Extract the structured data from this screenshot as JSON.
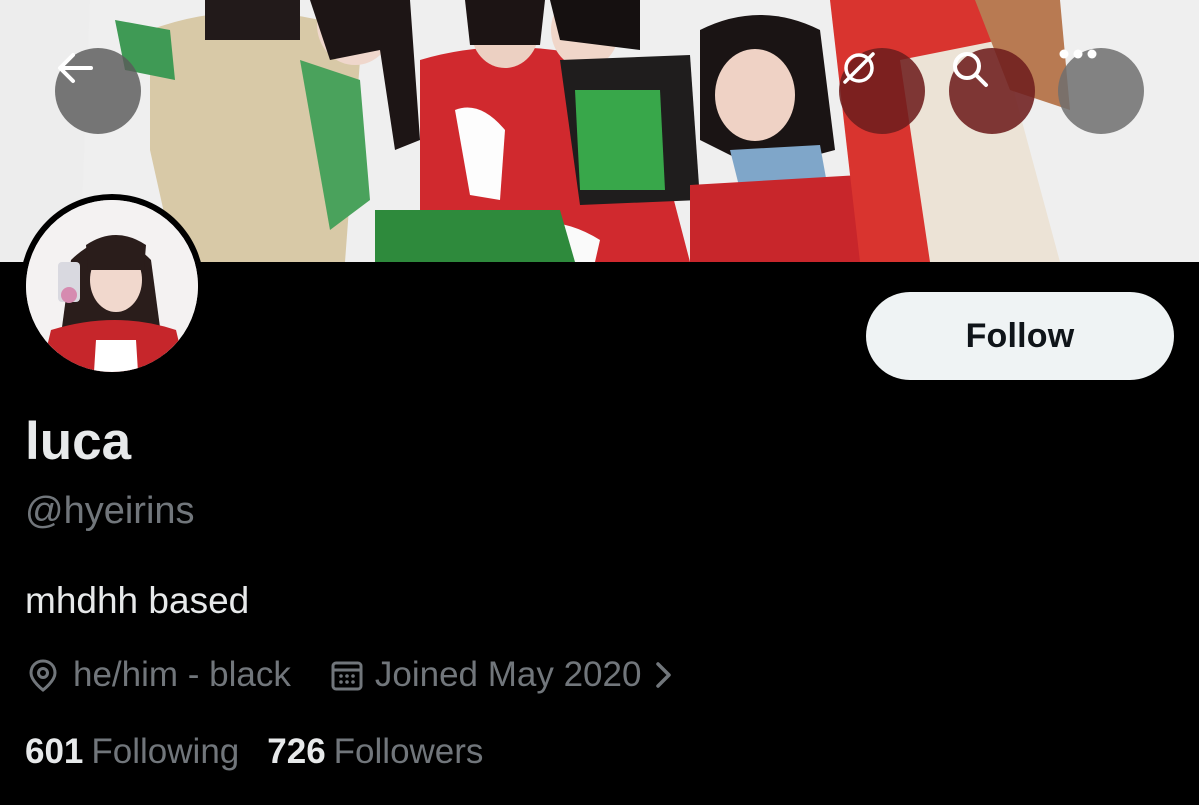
{
  "header": {
    "back_icon": "arrow-left-icon",
    "action_icons": [
      "no-sync-icon",
      "search-icon",
      "more-icon"
    ]
  },
  "profile": {
    "display_name": "luca",
    "handle": "@hyeirins",
    "bio": "mhdhh based",
    "location": "he/him - black",
    "joined": "Joined May 2020",
    "follow_label": "Follow",
    "following_count": "601",
    "following_label": "Following",
    "followers_count": "726",
    "followers_label": "Followers"
  },
  "colors": {
    "background": "#000000",
    "primary_text": "#e7e9ea",
    "secondary_text": "#71767b",
    "follow_button_bg": "#eff3f4",
    "follow_button_text": "#0f1419",
    "header_icon_bg_left": "#5f5f5f",
    "header_icon_bg_right": "#7a2020"
  }
}
